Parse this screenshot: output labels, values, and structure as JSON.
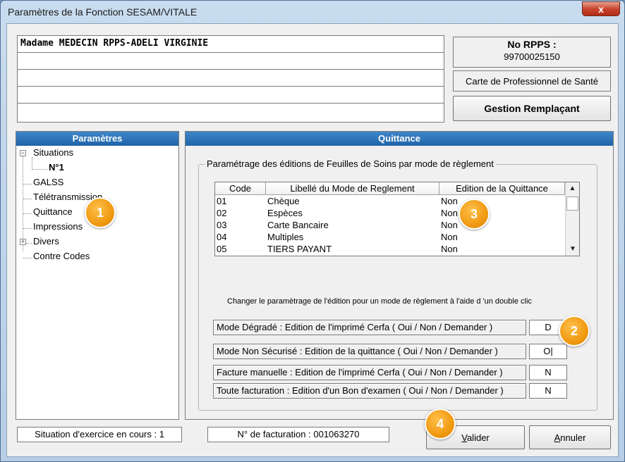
{
  "window": {
    "title": "Paramètres de la Fonction SESAM/VITALE"
  },
  "identity": {
    "lines": [
      "Madame MEDECIN RPPS-ADELI VIRGINIE",
      "",
      "",
      "",
      ""
    ],
    "rpps_label": "No RPPS :",
    "rpps_value": "99700025150",
    "card_type": "Carte de Professionnel de Santé",
    "replacement_button": "Gestion Remplaçant"
  },
  "left_panel": {
    "header": "Paramètres",
    "tree": {
      "situations": "Situations",
      "n1": "N°1",
      "galss": "GALSS",
      "teletransmission": "Télétransmission",
      "quittance": "Quittance",
      "impressions": "Impressions",
      "divers": "Divers",
      "contre_codes": "Contre Codes"
    }
  },
  "right_panel": {
    "header": "Quittance",
    "group_title": "Paramétrage des éditions de Feuilles de Soins par mode de règlement",
    "columns": [
      "Code",
      "Libellé du Mode de Reglement",
      "Edition de la Quittance"
    ],
    "rows": [
      [
        "01",
        "Chèque",
        "Non"
      ],
      [
        "02",
        "Espèces",
        "Non"
      ],
      [
        "03",
        "Carte Bancaire",
        "Non"
      ],
      [
        "04",
        "Multiples",
        "Non"
      ],
      [
        "05",
        "TIERS PAYANT",
        "Non"
      ]
    ],
    "hint": "Changer le paramètrage de l'édition pour un mode de règlement à l'aide d 'un double clic",
    "options": [
      {
        "label": "Mode Dégradé : Edition de l'imprimé Cerfa  ( Oui / Non / Demander )",
        "value": "D"
      },
      {
        "label": "Mode Non Sécurisé : Edition de la quittance  ( Oui / Non / Demander )",
        "value": "O|"
      },
      {
        "label": "Facture manuelle : Edition de l'imprimé Cerfa  ( Oui / Non / Demander )",
        "value": "N"
      },
      {
        "label": "Toute facturation : Edition d'un Bon d'examen ( Oui / Non / Demander )",
        "value": "N"
      }
    ]
  },
  "status": {
    "situation": "Situation d'exercice en cours : 1",
    "facturation": "N° de facturation : 001063270"
  },
  "buttons": {
    "valider": "Valider",
    "annuler": "Annuler",
    "close": "x"
  },
  "badges": [
    "1",
    "2",
    "3",
    "4"
  ],
  "colors": {
    "header_blue": "#1f64a8",
    "badge_orange": "#f09a12",
    "close_red": "#c8452f"
  }
}
